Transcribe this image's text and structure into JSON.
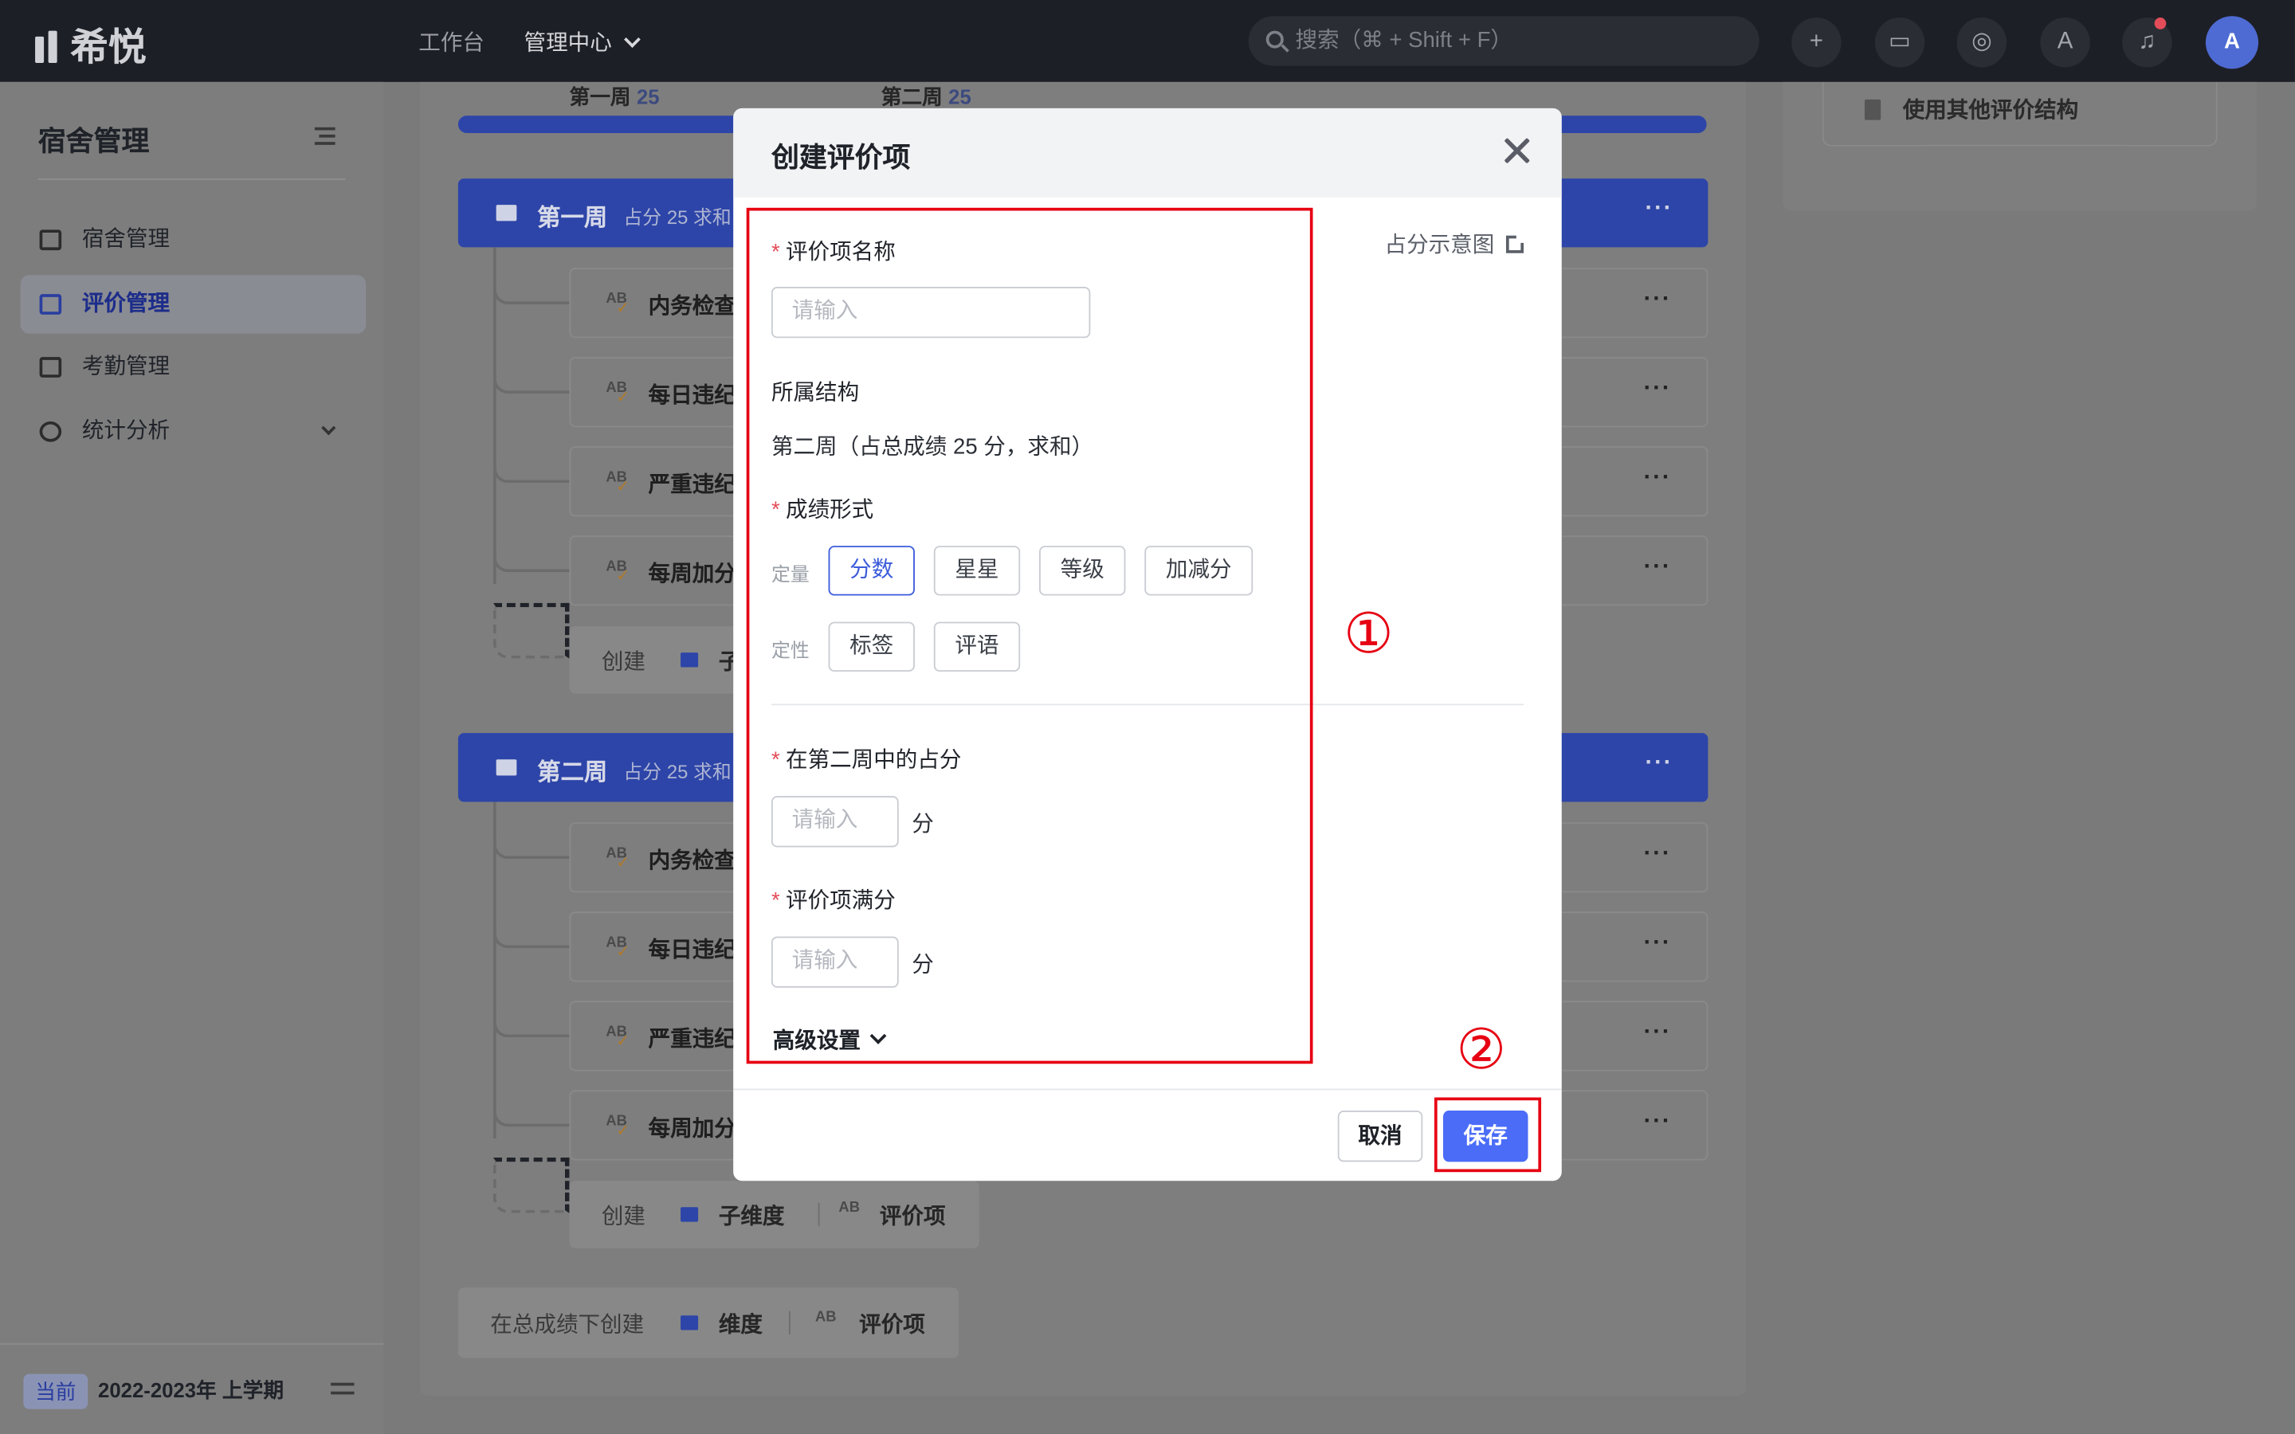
{
  "topbar": {
    "logo": "希悦",
    "nav": [
      "工作台",
      "管理中心"
    ],
    "search_placeholder": "搜索（⌘ + Shift + F）",
    "avatar": "A",
    "icons": [
      "plus-icon",
      "message-icon",
      "compass-icon",
      "translate-icon",
      "bell-icon"
    ]
  },
  "sidebar": {
    "title": "宿舍管理",
    "items": [
      "宿舍管理",
      "评价管理",
      "考勤管理",
      "统计分析"
    ],
    "active_index": 1,
    "term_tag": "当前",
    "term": "2022-2023年 上学期"
  },
  "content": {
    "right_action": "使用其他评价结构",
    "week_labels": [
      {
        "name": "第一周",
        "score": "25"
      },
      {
        "name": "第二周",
        "score": "25"
      }
    ],
    "progress_fraction": 1.0,
    "groups": [
      {
        "title": "第一周",
        "sub": "占分 25 求和",
        "items": [
          "内务检查",
          "每日违纪",
          "严重违纪",
          "每周加分"
        ]
      },
      {
        "title": "第二周",
        "sub": "占分 25 求和",
        "items": [
          "内务检查",
          "每日违纪",
          "严重违纪",
          "每周加分"
        ]
      }
    ],
    "create_row": {
      "label": "创建",
      "sub_dim": "子",
      "sub_dim_full": "子维度",
      "item": "评价项"
    },
    "root_create": {
      "label": "在总成绩下创建",
      "dim": "维度",
      "item": "评价项"
    },
    "ab_text": "AB"
  },
  "modal": {
    "title": "创建评价项",
    "diagram_link": "占分示意图",
    "name_label": "评价项名称",
    "name_placeholder": "请输入",
    "structure_label": "所属结构",
    "structure_value": "第二周（占总成绩 25 分，求和）",
    "format_label": "成绩形式",
    "quant_label": "定量",
    "quant_options": [
      "分数",
      "星星",
      "等级",
      "加减分"
    ],
    "qual_label": "定性",
    "qual_options": [
      "标签",
      "评语"
    ],
    "selected_option": "分数",
    "share_label": "在第二周中的占分",
    "share_placeholder": "请输入",
    "unit": "分",
    "full_label": "评价项满分",
    "full_placeholder": "请输入",
    "advanced": "高级设置",
    "cancel": "取消",
    "save": "保存"
  },
  "annotations": {
    "one": "①",
    "two": "②",
    "color": "#e60012"
  },
  "colors": {
    "primary": "#4a6cf7",
    "required": "#e34d59",
    "topbar": "#1d1f26"
  }
}
